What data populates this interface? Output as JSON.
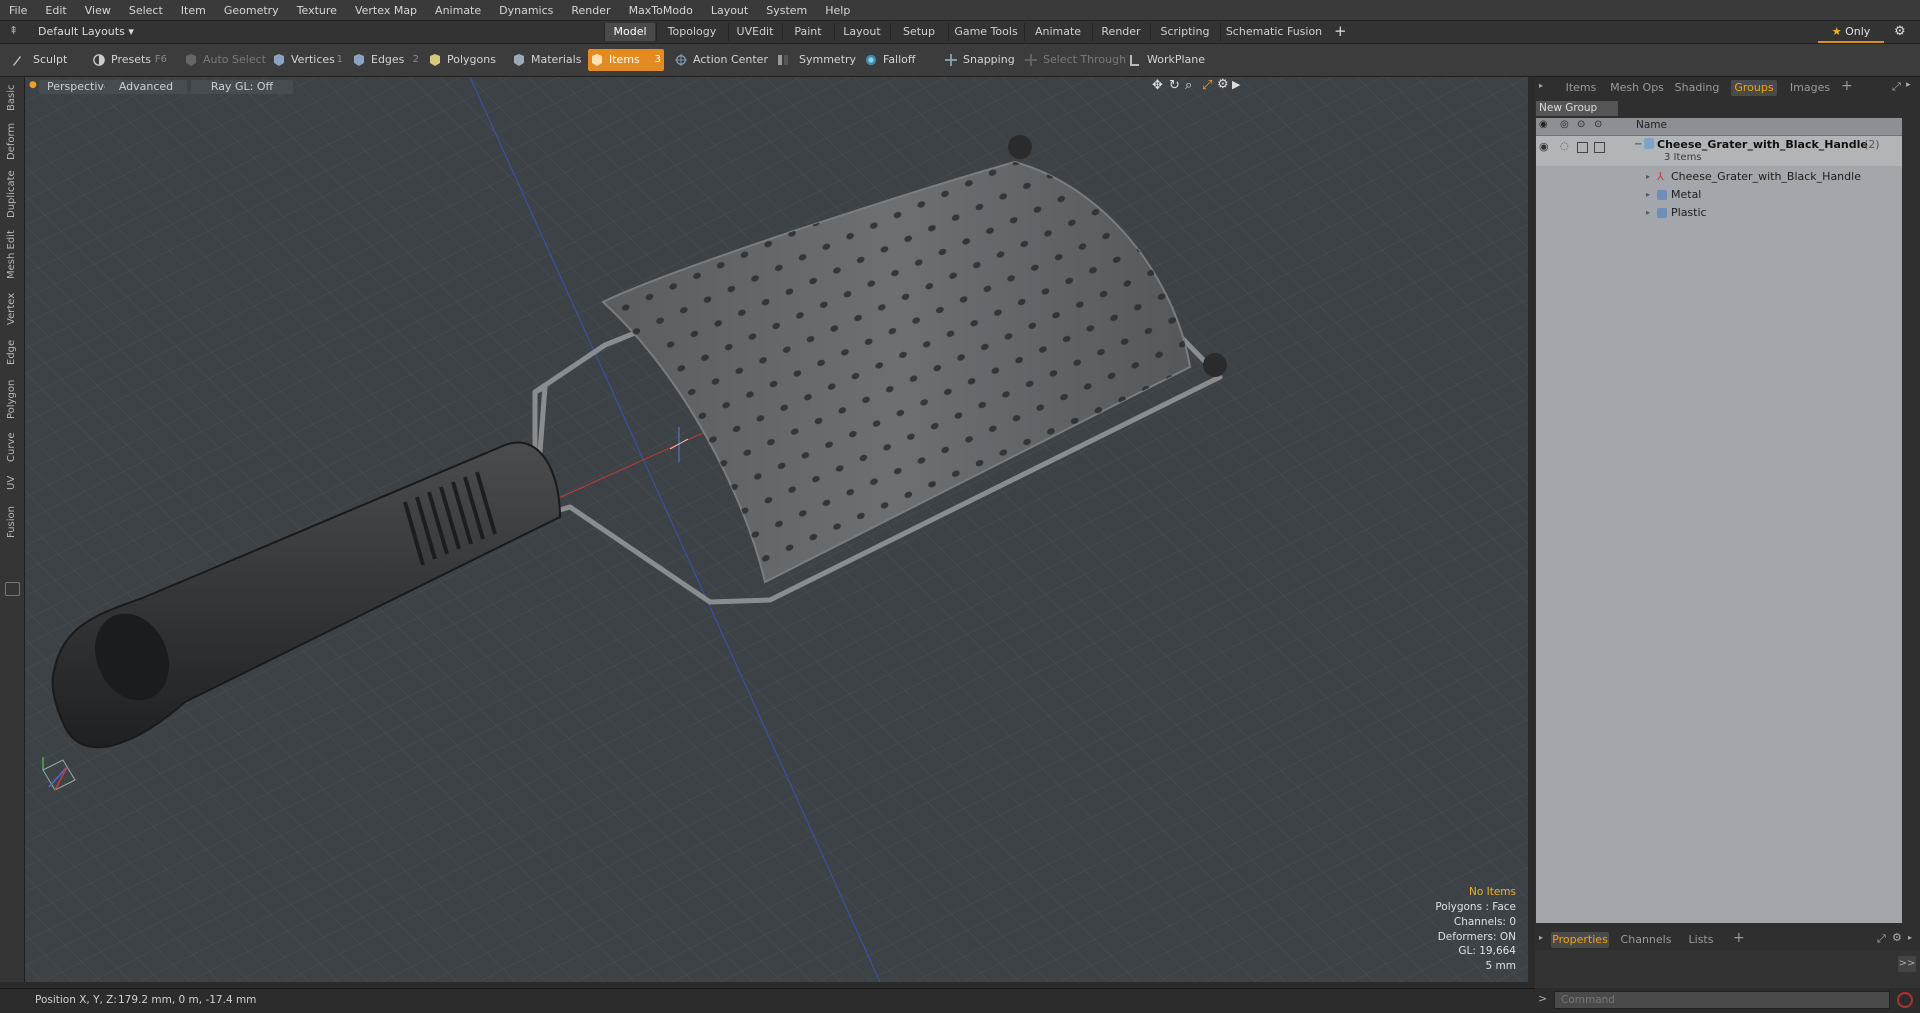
{
  "menu": [
    "File",
    "Edit",
    "View",
    "Select",
    "Item",
    "Geometry",
    "Texture",
    "Vertex Map",
    "Animate",
    "Dynamics",
    "Render",
    "MaxToModo",
    "Layout",
    "System",
    "Help"
  ],
  "layouts": {
    "default_label": "Default Layouts",
    "tabs": [
      "Model",
      "Topology",
      "UVEdit",
      "Paint",
      "Layout",
      "Setup",
      "Game Tools",
      "Animate",
      "Render",
      "Scripting",
      "Schematic Fusion"
    ],
    "active_tab": "Model",
    "only_label": "Only"
  },
  "toolbar": {
    "sculpt": "Sculpt",
    "presets": "Presets",
    "presets_key": "F6",
    "auto_select": "Auto Select",
    "vertices": "Vertices",
    "vertices_count": "1",
    "edges": "Edges",
    "edges_count": "2",
    "polygons": "Polygons",
    "materials": "Materials",
    "items": "Items",
    "items_count": "3",
    "action_center": "Action Center",
    "symmetry": "Symmetry",
    "falloff": "Falloff",
    "snapping": "Snapping",
    "select_through": "Select Through",
    "workplane": "WorkPlane"
  },
  "left_tabs": [
    "Basic",
    "Deform",
    "Duplicate",
    "Mesh Edit",
    "Vertex",
    "Edge",
    "Polygon",
    "Curve",
    "UV",
    "Fusion"
  ],
  "viewport": {
    "view_mode": "Perspective",
    "shading": "Advanced",
    "raygl": "Ray GL: Off",
    "info": {
      "selection": "No Items",
      "polygons": "Polygons : Face",
      "channels": "Channels: 0",
      "deformers": "Deformers: ON",
      "gl": "GL: 19,664",
      "scale": "5 mm"
    }
  },
  "right_panel": {
    "tabs": [
      "Items",
      "Mesh Ops",
      "Shading",
      "Groups",
      "Images"
    ],
    "active_tab": "Groups",
    "new_group": "New Group",
    "name_col": "Name",
    "group": {
      "name": "Cheese_Grater_with_Black_Handle",
      "count": "(2)",
      "items_label": "3 Items"
    },
    "children": [
      "Cheese_Grater_with_Black_Handle",
      "Metal",
      "Plastic"
    ],
    "bottom_tabs": [
      "Properties",
      "Channels",
      "Lists"
    ],
    "bottom_active": "Properties",
    "expand_label": ">>"
  },
  "status": {
    "position_label": "Position X, Y, Z:",
    "position_value": "179.2 mm, 0 m, -17.4 mm"
  },
  "command": {
    "placeholder": "Command"
  },
  "colors": {
    "accent": "#e38a20",
    "viewport_bg": "#3d4247",
    "highlight_text": "#f0b030"
  }
}
